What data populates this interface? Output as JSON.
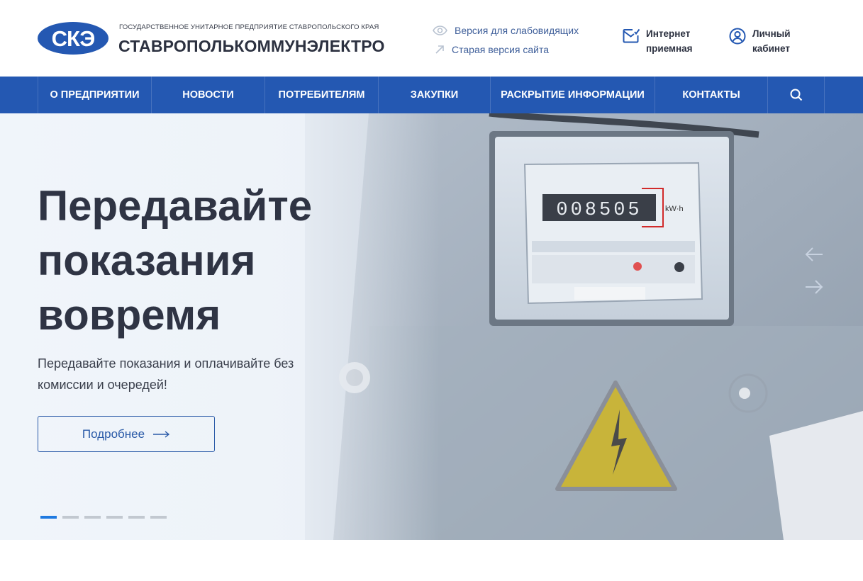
{
  "header": {
    "org_subtitle": "ГОСУДАРСТВЕННОЕ УНИТАРНОЕ ПРЕДПРИЯТИЕ СТАВРОПОЛЬСКОГО КРАЯ",
    "org_name": "СТАВРОПОЛЬКОММУНЭЛЕКТРО",
    "accessibility_link": "Версия для слабовидящих",
    "old_version_link": "Старая версия сайта",
    "reception": {
      "line1": "Интернет",
      "line2": "приемная"
    },
    "cabinet": {
      "line1": "Личный",
      "line2": "кабинет"
    }
  },
  "nav": {
    "items": [
      {
        "label": "О ПРЕДПРИЯТИИ"
      },
      {
        "label": "НОВОСТИ"
      },
      {
        "label": "ПОТРЕБИТЕЛЯМ"
      },
      {
        "label": "ЗАКУПКИ"
      },
      {
        "label": "РАСКРЫТИЕ ИНФОРМАЦИИ"
      },
      {
        "label": "КОНТАКТЫ"
      }
    ],
    "search_icon": "search-icon"
  },
  "hero": {
    "title_lines": [
      "Передавайте",
      "показания",
      "вовремя"
    ],
    "description": "Передавайте показания и оплачивайте без комиссии и очередей!",
    "button_label": "Подробнее",
    "slides_count": 6,
    "active_slide": 1,
    "meter_reading": "008505",
    "meter_unit": "kW·h"
  },
  "colors": {
    "brand_blue": "#2458b2",
    "accent_blue": "#1f7ae0",
    "text_dark": "#2f3444"
  }
}
